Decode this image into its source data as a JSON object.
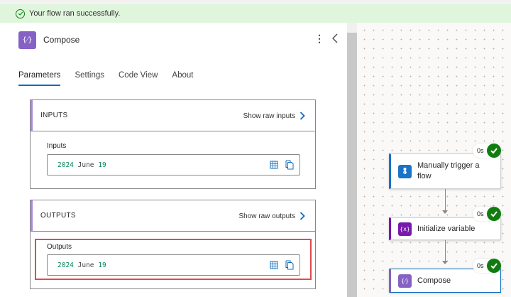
{
  "banner": {
    "message": "Your flow ran successfully."
  },
  "panel": {
    "title": "Compose",
    "icon_text": "{⁄}",
    "tabs": [
      {
        "label": "Parameters",
        "active": true
      },
      {
        "label": "Settings",
        "active": false
      },
      {
        "label": "Code View",
        "active": false
      },
      {
        "label": "About",
        "active": false
      }
    ],
    "inputs": {
      "section": "INPUTS",
      "raw_link": "Show raw inputs",
      "field_label": "Inputs",
      "value_year": "2024",
      "value_month": "June",
      "value_day": "19"
    },
    "outputs": {
      "section": "OUTPUTS",
      "raw_link": "Show raw outputs",
      "field_label": "Outputs",
      "value_year": "2024",
      "value_month": "June",
      "value_day": "19"
    }
  },
  "flow": {
    "nodes": [
      {
        "label_line1": "Manually trigger a",
        "label_line2": "flow",
        "duration": "0s",
        "icon": "touch-icon",
        "icon_color": "#1a73c8"
      },
      {
        "label_line1": "Initialize variable",
        "label_line2": "",
        "duration": "0s",
        "icon_text": "{x}",
        "icon_color": "#7719aa"
      },
      {
        "label_line1": "Compose",
        "label_line2": "",
        "duration": "0s",
        "icon_text": "{⁄}",
        "icon_color": "#8661c5"
      }
    ]
  },
  "colors": {
    "accent": "#0f6cbd",
    "success": "#107c10",
    "highlight": "#e34a4a"
  }
}
